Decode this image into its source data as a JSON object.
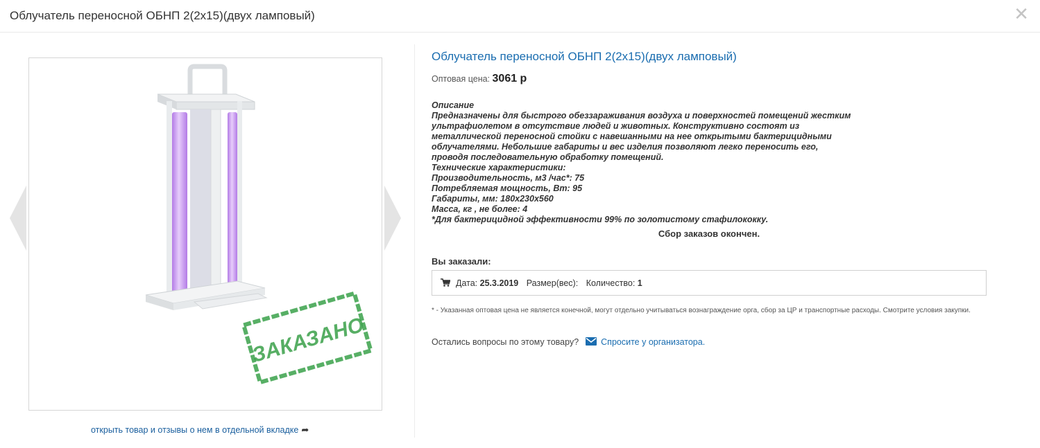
{
  "modal": {
    "title": "Облучатель переносной ОБНП 2(2х15)(двух ламповый)",
    "close_label": "✕"
  },
  "gallery": {
    "stamp_text": "ЗАКАЗАНО",
    "open_link": "открыть товар и отзывы о нем в отдельной вкладке",
    "open_link_icon": "share-arrow-icon"
  },
  "product": {
    "title": "Облучатель переносной ОБНП 2(2х15)(двух ламповый)",
    "price_label": "Оптовая цена:",
    "price_value": "3061 р",
    "description_lines": [
      "Описание",
      "Предназначены для быстрого обеззараживания воздуха и поверхностей помещений жестким ультрафиолетом в отсутствие людей и животных. Конструктивно состоят из металлической переносной стойки с навешанными на нее открытыми бактерицидными облучателями. Небольшие габариты и вес изделия позволяют легко переносить его, проводя последовательную обработку помещений.",
      "Технические характеристики:",
      "Производительность, м3 /час*: 75",
      "Потребляемая мощность, Вт: 95",
      "Габариты, мм: 180х230х560",
      "Масса, кг , не более: 4",
      "*Для бактерицидной эффективности 99% по золотистому стафилококку."
    ],
    "status": "Сбор заказов окончен."
  },
  "order": {
    "heading": "Вы заказали:",
    "icon": "cart-icon",
    "date_label": "Дата:",
    "date_value": "25.3.2019",
    "size_label": "Размер(вес):",
    "qty_label": "Количество:",
    "qty_value": "1"
  },
  "footnote": "* - Указанная оптовая цена не является конечной, могут отдельно учитываться вознаграждение орга, сбор за ЦР и транспортные расходы. Смотрите условия закупки.",
  "questions": {
    "text": "Остались вопросы по этому товару?",
    "icon": "envelope-icon",
    "link": "Спросите у организатора."
  },
  "colors": {
    "link": "#1a6db0",
    "stamp": "#3aa14a",
    "lamp": "#c89bf0"
  }
}
